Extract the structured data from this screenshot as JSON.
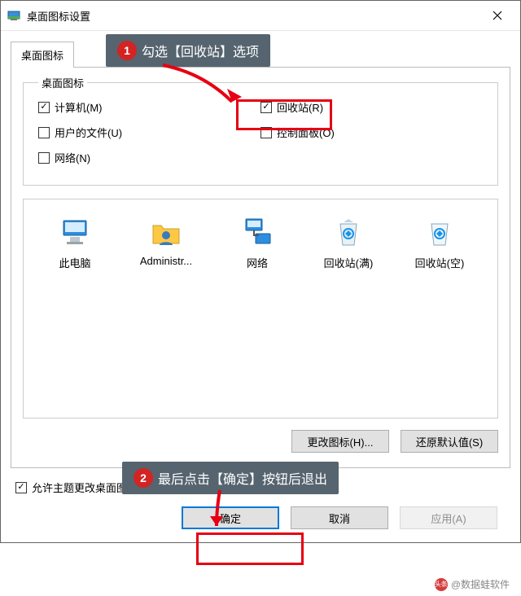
{
  "window": {
    "title": "桌面图标设置"
  },
  "tabs": {
    "active": "桌面图标"
  },
  "group": {
    "legend": "桌面图标",
    "checks": {
      "computer": {
        "label": "计算机(M)",
        "checked": true
      },
      "recycle": {
        "label": "回收站(R)",
        "checked": true
      },
      "userfiles": {
        "label": "用户的文件(U)",
        "checked": false
      },
      "ctrlpanel": {
        "label": "控制面板(O)",
        "checked": false
      },
      "network": {
        "label": "网络(N)",
        "checked": false
      }
    }
  },
  "icons": {
    "items": [
      {
        "label": "此电脑",
        "kind": "pc"
      },
      {
        "label": "Administr...",
        "kind": "user"
      },
      {
        "label": "网络",
        "kind": "network"
      },
      {
        "label": "回收站(满)",
        "kind": "bin_full"
      },
      {
        "label": "回收站(空)",
        "kind": "bin_empty"
      }
    ]
  },
  "buttons": {
    "change_icon": "更改图标(H)...",
    "restore_default": "还原默认值(S)",
    "ok": "确定",
    "cancel": "取消",
    "apply": "应用(A)"
  },
  "allow_theme": {
    "label": "允许主题更改桌面图标(L)",
    "checked": true
  },
  "callouts": {
    "step1": {
      "num": "1",
      "text": "勾选【回收站】选项"
    },
    "step2": {
      "num": "2",
      "text": "最后点击【确定】按钮后退出"
    }
  },
  "watermark": {
    "prefix": "头条",
    "text": "@数据蛙软件"
  }
}
